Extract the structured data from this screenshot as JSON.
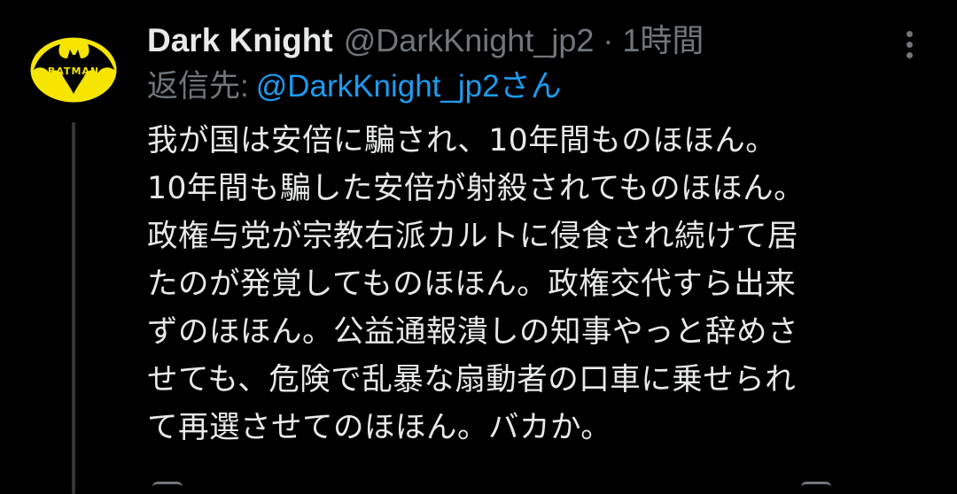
{
  "tweet": {
    "display_name": "Dark Knight",
    "handle": "@DarkKnight_jp2",
    "separator": "·",
    "time": "1時間",
    "reply_prefix": "返信先:",
    "reply_target": "@DarkKnight_jp2さん",
    "body_lines": [
      "我が国は安倍に騙され、10年間ものほほん。",
      "10年間も騙した安倍が射殺されてものほほん。",
      "政権与党が宗教右派カルトに侵食され続けて居",
      "たのが発覚してものほほん。政権交代すら出来",
      "ずのほほん。公益通報潰しの知事やっと辞めさ",
      "せても、危険で乱暴な扇動者の口車に乗せられ",
      "て再選させてのほほん。バカか。"
    ],
    "avatar_text": "BATMAN"
  },
  "icons": {
    "more": "more-vertical-icon"
  },
  "colors": {
    "background": "#000000",
    "primary_text": "#e7e9ea",
    "secondary_text": "#71767b",
    "link": "#1d9bf0",
    "avatar_yellow": "#f5e500"
  }
}
